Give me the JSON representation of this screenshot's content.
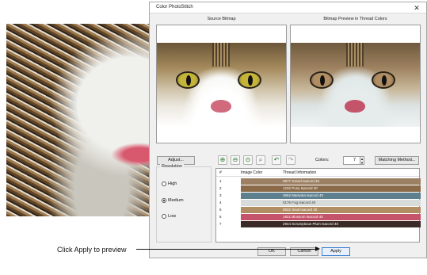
{
  "dialog": {
    "title": "Color PhotoStitch",
    "close_glyph": "✕"
  },
  "panels": {
    "source_label": "Source Bitmap",
    "preview_label": "Bitmap Preview in Thread Colors"
  },
  "toolbar": {
    "adjust_label": "Adjust...",
    "icons": [
      "zoom-fit-icon",
      "zoom-in-icon",
      "zoom-out-icon",
      "zoom-area-icon",
      "undo-icon",
      "redo-icon"
    ],
    "colors_label": "Colors:",
    "colors_value": "7",
    "matching_label": "Matching Method..."
  },
  "resolution": {
    "title": "Resolution",
    "options": [
      "High",
      "Medium",
      "Low"
    ],
    "selected": "Medium"
  },
  "table": {
    "headers": [
      "#",
      "Image Color",
      "Thread Information"
    ],
    "rows": [
      {
        "num": "1",
        "info": "0977 Grand Isacord 40",
        "color": "#9c8064"
      },
      {
        "num": "2",
        "info": "1232 Pony Isacord 40",
        "color": "#8a6a48"
      },
      {
        "num": "3",
        "info": "3652 Marsaha Isacord 40",
        "color": "#5e7f8d"
      },
      {
        "num": "4",
        "info": "0176 Fog Isacord 40",
        "color": "#d7dcda"
      },
      {
        "num": "5",
        "info": "0832 Sisal Isacord 40",
        "color": "#b08d63"
      },
      {
        "num": "6",
        "info": "1921 Blossom Isacord 40",
        "color": "#c3546a"
      },
      {
        "num": "7",
        "info": "2944 Scrumptious Plum Isacord 40",
        "color": "#3a2a26"
      }
    ]
  },
  "buttons": {
    "ok": "OK",
    "cancel": "Cancel",
    "apply": "Apply"
  },
  "callout": "Click Apply to preview"
}
